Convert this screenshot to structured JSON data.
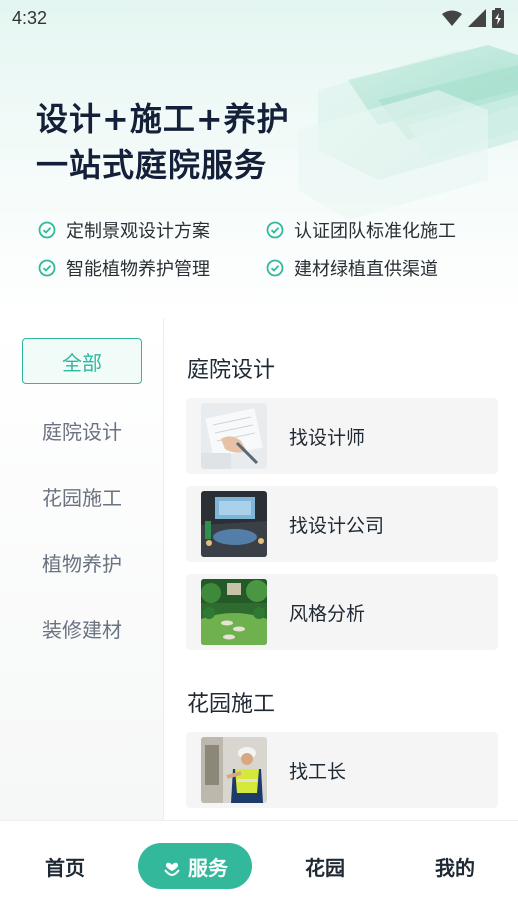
{
  "status_bar": {
    "time": "4:32"
  },
  "hero": {
    "title_line1": "设计+施工+养护",
    "title_line2": "一站式庭院服务",
    "features": [
      "定制景观设计方案",
      "认证团队标准化施工",
      "智能植物养护管理",
      "建材绿植直供渠道"
    ]
  },
  "sidebar": {
    "items": [
      {
        "label": "全部",
        "active": true
      },
      {
        "label": "庭院设计"
      },
      {
        "label": "花园施工"
      },
      {
        "label": "植物养护"
      },
      {
        "label": "装修建材"
      }
    ]
  },
  "sections": [
    {
      "title": "庭院设计",
      "cards": [
        {
          "label": "找设计师",
          "icon": "designer-photo"
        },
        {
          "label": "找设计公司",
          "icon": "company-photo"
        },
        {
          "label": "风格分析",
          "icon": "garden-photo"
        }
      ]
    },
    {
      "title": "花园施工",
      "cards": [
        {
          "label": "找工长",
          "icon": "foreman-photo"
        }
      ]
    }
  ],
  "tabbar": {
    "tabs": [
      {
        "label": "首页"
      },
      {
        "label": "服务",
        "active": true,
        "icon": "heart-hand-icon"
      },
      {
        "label": "花园"
      },
      {
        "label": "我的"
      }
    ]
  },
  "colors": {
    "accent": "#34b89c",
    "text": "#1f2933",
    "muted": "#6b7280"
  }
}
